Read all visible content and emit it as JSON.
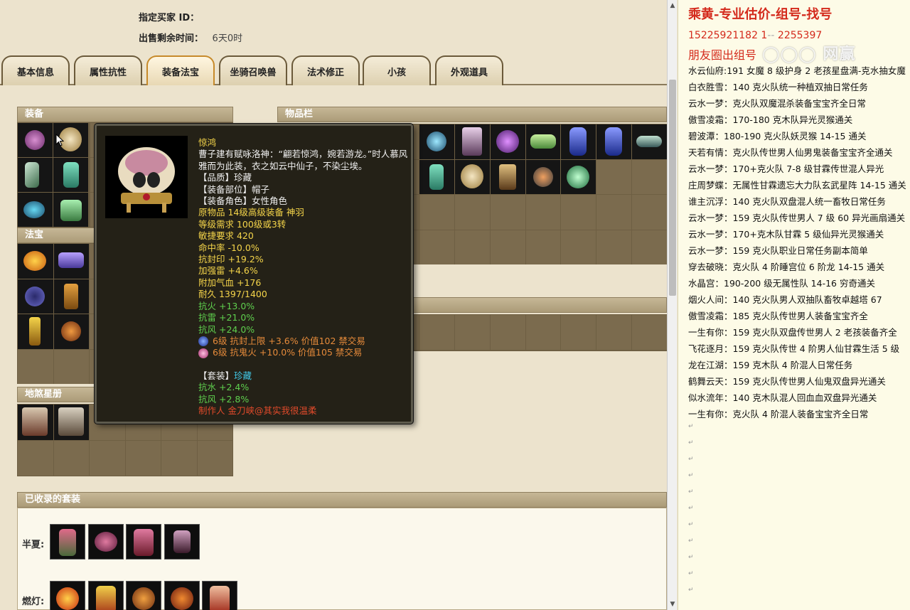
{
  "buyer": {
    "label": "指定买家 ID：",
    "value": ""
  },
  "time_left": {
    "label": "出售剩余时间：",
    "value": "6天0时"
  },
  "tabs": [
    "基本信息",
    "属性抗性",
    "装备法宝",
    "坐骑召唤兽",
    "法术修正",
    "小孩",
    "外观道具"
  ],
  "active_tab": "装备法宝",
  "panels": {
    "equip": "装备",
    "fabao": "法宝",
    "xingce": "地煞星册",
    "inventory": "物品栏",
    "suits": "已收录的套装"
  },
  "tooltip": {
    "name": "惊鸿",
    "desc": "曹子建有赋咏洛神：“翩若惊鸿，婉若游龙。”时人慕风雅而为此装，衣之如云中仙子，不染尘埃。",
    "quality": "【品质】珍藏",
    "slot": "【装备部位】帽子",
    "role": "【装备角色】女性角色",
    "origin": "原物品 14级高级装备 神羽",
    "level_req": "等级需求 100级或3转",
    "agi_req": "敏捷要求 420",
    "stats_white": [
      "命中率 -10.0%",
      "抗封印 +19.2%",
      "加强雷 +4.6%",
      "附加气血 +176",
      "耐久 1397/1400"
    ],
    "stats_green": [
      "抗火 +13.0%",
      "抗雷 +21.0%",
      "抗风 +24.0%"
    ],
    "gems": [
      "6级 抗封上限 +3.6% 价值102 禁交易",
      "6级 抗鬼火 +10.0% 价值105 禁交易"
    ],
    "suit_label": "【套装】",
    "suit_name": "珍藏",
    "suit_stats": [
      "抗水 +2.4%",
      "抗风 +2.8%"
    ],
    "maker": "制作人 金刀峡@其实我很温柔"
  },
  "suit_rows": [
    {
      "label": "半夏:"
    },
    {
      "label": "燃灯:"
    }
  ],
  "notes": {
    "title": "乘黄-专业估价-组号-找号",
    "phone": "15225921182    1",
    "phone2": "2255397",
    "friend": "朋友圈出组号",
    "lines": [
      "水云仙府:191 女魔 8 级护身 2 老孩星盘满-克水抽女魔",
      "白衣胜雪：140 克火队统一种植双抽日常任务",
      "云水一梦：克火队双魔混杀装备宝宝齐全日常",
      "傲雪凌霜：170-180 克木队异光灵猴通关",
      "碧波潭：180-190 克火队妖灵猴 14-15 通关",
      "天若有情：克火队传世男人仙男鬼装备宝宝齐全通关",
      "云水一梦：170+克火队 7-8 级甘霖传世混人异光",
      "庄周梦蝶：无属性甘霖遗忘大力队玄武星阵 14-15 通关",
      "谁主沉浮：140 克火队双盘混人统一畜牧日常任务",
      "云水一梦：159 克火队传世男人 7 级 60 异光画扇通关",
      "云水一梦：170+克木队甘霖 5 级仙异光灵猴通关",
      "云水一梦：159 克火队职业日常任务副本简单",
      "穿去破晓：克火队 4 阶睡宫位 6 阶龙 14-15 通关",
      "水晶宫：190-200 级无属性队 14-16 穷奇通关",
      "烟火人间：140 克火队男人双抽队畜牧卓越塔 67",
      "傲雪凌霜：185 克火队传世男人装备宝宝齐全",
      "一生有你：159 克火队双盘传世男人 2 老孩装备齐全",
      "飞花逐月：159 克火队传世 4 阶男人仙甘霖生活 5 级",
      "龙在江湖：159 克木队 4 阶混人日常任务",
      "鹤舞云天：159 克火队传世男人仙鬼双盘异光通关",
      "似水流年：140 克木队混人回血血双盘异光通关",
      "一生有你：克火队 4 阶混人装备宝宝齐全日常"
    ],
    "mark": "↵"
  },
  "colors": {
    "accent_red": "#d42a1c",
    "tab_active": "#c78a2a",
    "tooltip_bg": "#242117"
  }
}
